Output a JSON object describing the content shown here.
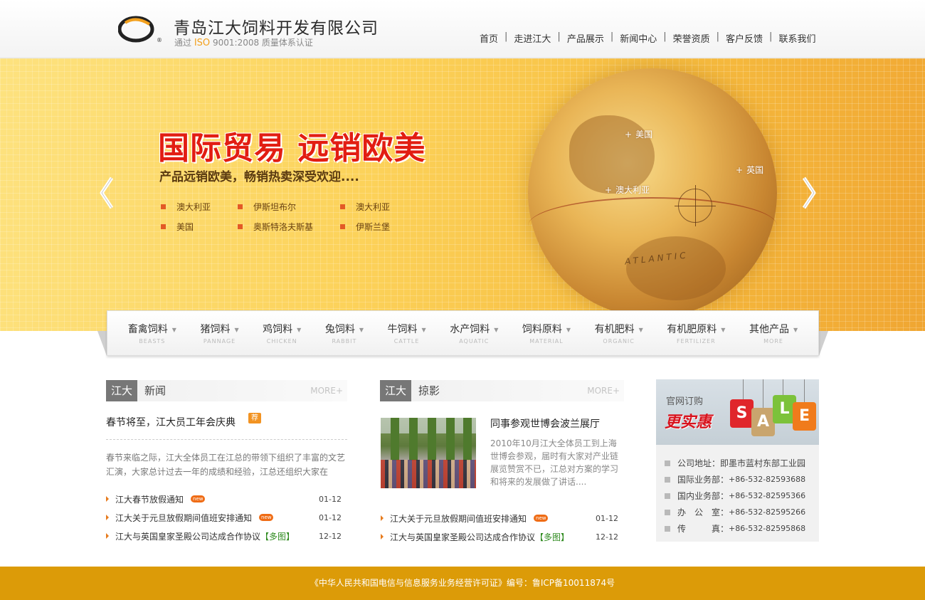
{
  "header": {
    "company_name": "青岛江大饲料开发有限公司",
    "logo_reg": "®",
    "iso_prefix": "通过",
    "iso_mark": "ISO",
    "iso_suffix": "9001:2008 质量体系认证"
  },
  "nav": {
    "items": [
      "首页",
      "走进江大",
      "产品展示",
      "新闻中心",
      "荣誉资质",
      "客户反馈",
      "联系我们"
    ],
    "separator": "|"
  },
  "banner": {
    "headline": "国际贸易 远销欧美",
    "subline": "产品远销欧美，畅销热卖深受欢迎....",
    "countries": [
      "澳大利亚",
      "伊斯坦布尔",
      "澳大利亚",
      "美国",
      "奥斯特洛夫斯基",
      "伊斯兰堡"
    ],
    "globe_labels": [
      "美国",
      "英国",
      "澳大利亚"
    ],
    "globe_plus": "+",
    "globe_text": "ATLANTIC"
  },
  "categories": [
    {
      "cn": "畜禽饲料",
      "en": "BEASTS"
    },
    {
      "cn": "猪饲料",
      "en": "PANNAGE"
    },
    {
      "cn": "鸡饲料",
      "en": "CHICKEN"
    },
    {
      "cn": "兔饲料",
      "en": "RABBIT"
    },
    {
      "cn": "牛饲料",
      "en": "CATTLE"
    },
    {
      "cn": "水产饲料",
      "en": "AQUATIC"
    },
    {
      "cn": "饲料原料",
      "en": "MATERIAL"
    },
    {
      "cn": "有机肥料",
      "en": "ORGANIC"
    },
    {
      "cn": "有机肥原料",
      "en": "FERTILIZER"
    },
    {
      "cn": "其他产品",
      "en": "MORE"
    }
  ],
  "news": {
    "tag": "江大",
    "title": "新闻",
    "more": "MORE+",
    "feature_title": "春节将至，江大员工年会庆典",
    "feature_badge": "荐",
    "summary": "春节来临之际，江大全体员工在江总的带领下组织了丰富的文艺汇演，大家总计过去一年的成绩和经验，江总还组织大家在",
    "items": [
      {
        "title": "江大春节放假通知",
        "badge": "new",
        "extra": "",
        "date": "01-12"
      },
      {
        "title": "江大关于元旦放假期间值班安排通知",
        "badge": "new",
        "extra": "",
        "date": "01-12"
      },
      {
        "title": "江大与英国皇家圣殿公司达成合作协议",
        "badge": "",
        "extra": "【多图】",
        "date": "12-12"
      }
    ]
  },
  "photos": {
    "tag": "江大",
    "title": "掠影",
    "more": "MORE+",
    "feature_title": "同事参观世博会波兰展厅",
    "feature_desc": "2010年10月江大全体员工到上海世博会参观，届时有大家对产业链展览赞赏不已，江总对方案的学习和将来的发展做了讲话....",
    "items": [
      {
        "title": "江大关于元旦放假期间值班安排通知",
        "badge": "new",
        "extra": "",
        "date": "01-12"
      },
      {
        "title": "江大与英国皇家圣殿公司达成合作协议",
        "badge": "",
        "extra": "【多图】",
        "date": "12-12"
      }
    ]
  },
  "sidebar": {
    "ad_small": "官网订购",
    "ad_big": "更实惠",
    "ad_letters": [
      "S",
      "A",
      "L",
      "E"
    ],
    "ad_colors": [
      "#e0262b",
      "#c9a56e",
      "#7cc23a",
      "#f07b1c"
    ],
    "contacts": [
      {
        "label": "公司地址：",
        "value": "即墨市蓝村东部工业园"
      },
      {
        "label": "国际业务部：",
        "value": "+86-532-82593688"
      },
      {
        "label": "国内业务部：",
        "value": "+86-532-82595366"
      },
      {
        "label": "办　公　室：",
        "value": "+86-532-82595266"
      },
      {
        "label": "传　　　真：",
        "value": "+86-532-82595868"
      }
    ]
  },
  "footer": {
    "text": "《中华人民共和国电信与信息服务业务经营许可证》编号：鲁ICP备10011874号"
  },
  "colors": {
    "accent_orange": "#dc9b08",
    "headline_red": "#e21d12",
    "bullet_orange": "#e35a26"
  }
}
